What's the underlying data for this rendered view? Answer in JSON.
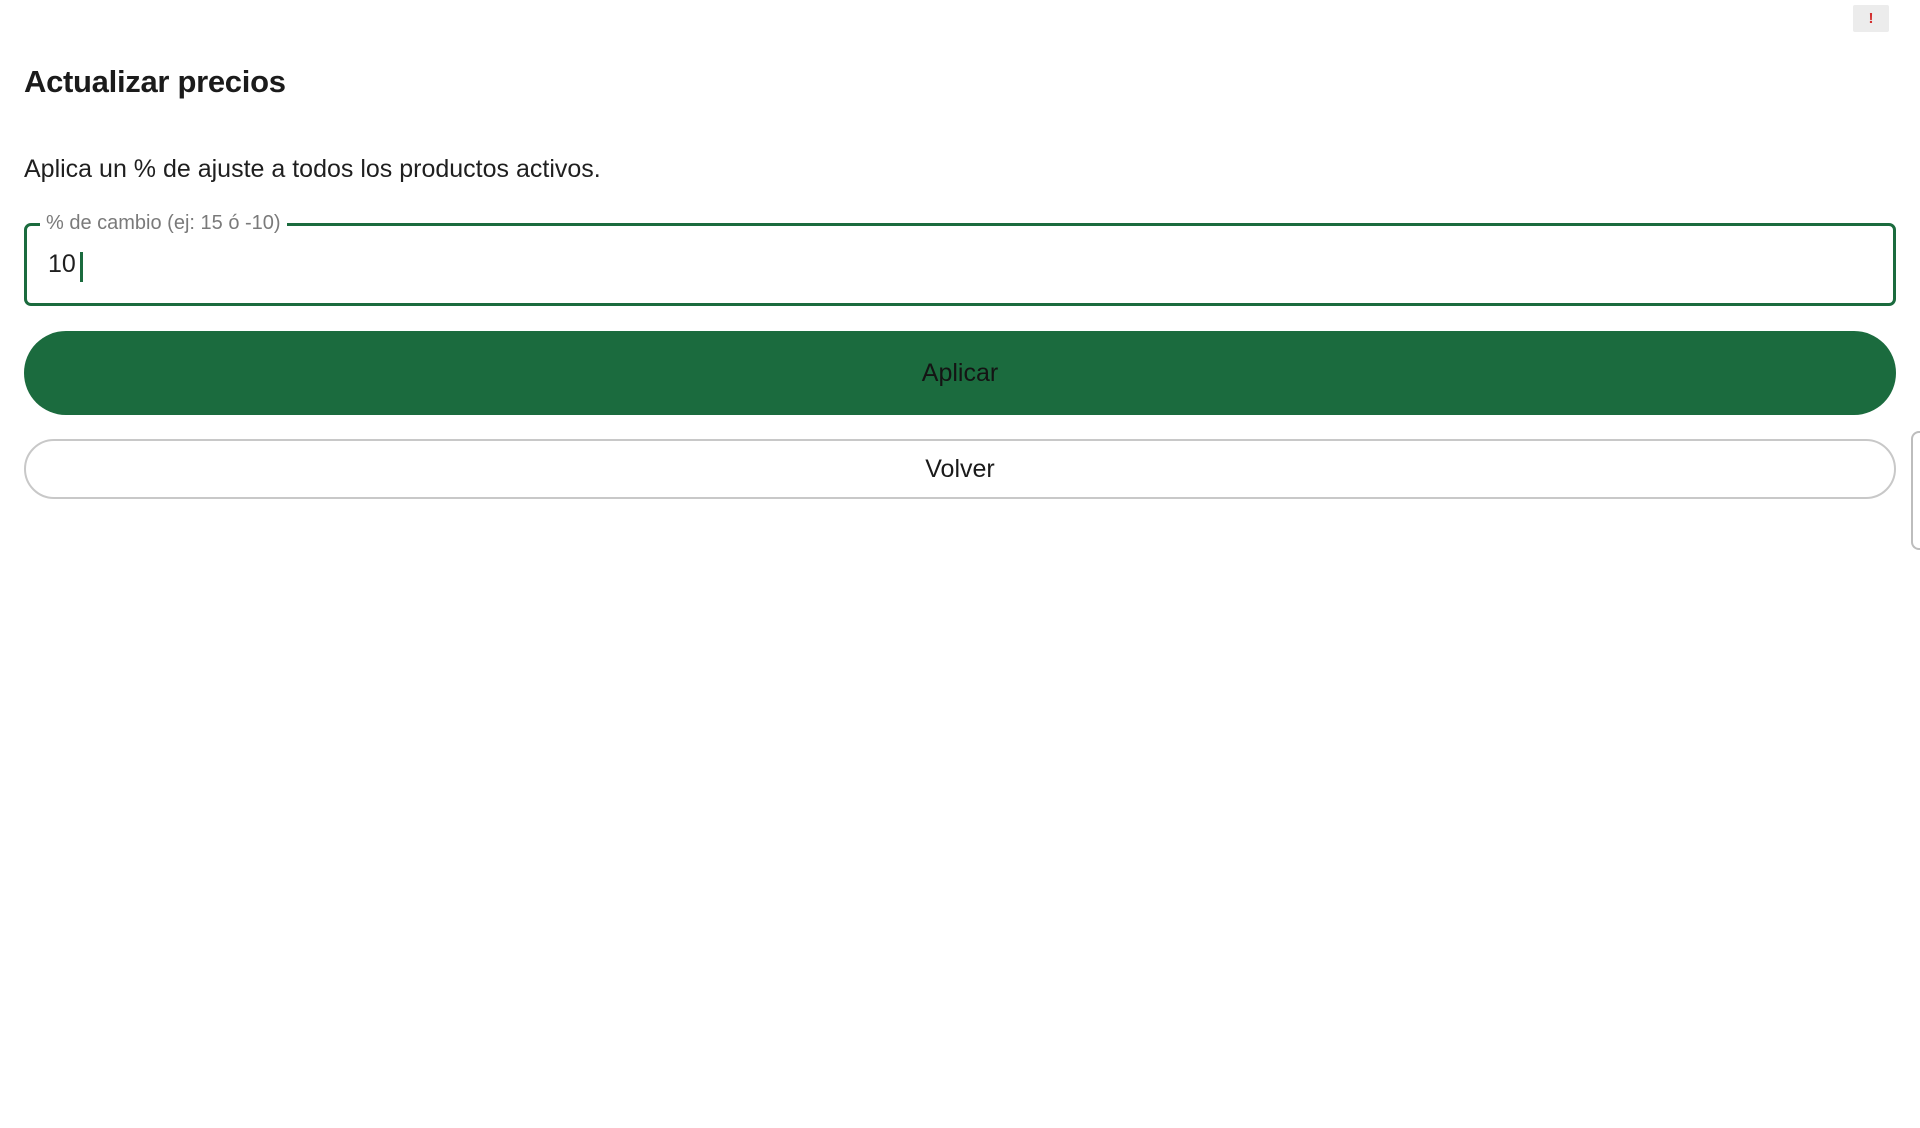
{
  "status_indicator": {
    "symbol": "!",
    "icon": "alert-icon",
    "color": "#d32f2f"
  },
  "page": {
    "title": "Actualizar precios",
    "description": "Aplica un % de ajuste a todos los productos activos."
  },
  "change_field": {
    "label": "% de cambio (ej: 15 ó -10)",
    "value": "10"
  },
  "actions": {
    "apply_label": "Aplicar",
    "back_label": "Volver"
  },
  "colors": {
    "accent": "#1b6b3e",
    "outline": "#c8c8c8",
    "background": "#ffffff"
  }
}
